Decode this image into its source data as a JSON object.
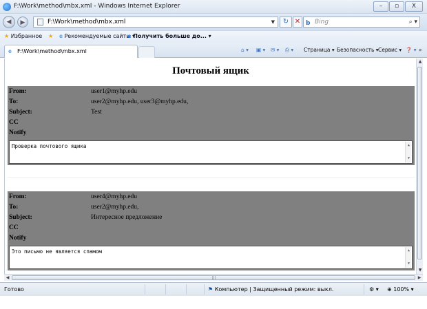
{
  "window": {
    "title": "F:\\Work\\method\\mbx.xml - Windows Internet Explorer",
    "minimize_icon": "minimize-icon",
    "maximize_icon": "maximize-icon",
    "close_glyph": "X"
  },
  "address_bar": {
    "url": "F:\\Work\\method\\mbx.xml",
    "search_placeholder": "Bing"
  },
  "favorites_bar": {
    "favorites_label": "Избранное",
    "suggested_sites_label": "Рекомендуемые сайты ▾",
    "get_more_label": "Получить больше до... ▾"
  },
  "tabs": [
    {
      "label": "F:\\Work\\method\\mbx.xml"
    }
  ],
  "command_bar": {
    "page_label": "Страница ▾",
    "safety_label": "Безопасность ▾",
    "tools_label": "Сервис ▾"
  },
  "page": {
    "title": "Почтовый ящик",
    "field_labels": {
      "from": "From:",
      "to": "To:",
      "subject": "Subject:",
      "cc": "CC",
      "notify": "Notify"
    },
    "messages": [
      {
        "from": "user1@myhp.edu",
        "to": "user2@myhp.edu, user3@myhp.edu,",
        "subject": "Test",
        "cc": "",
        "notify": "",
        "body": "Проверка почтового ящика"
      },
      {
        "from": "user4@myhp.edu",
        "to": "user2@myhp.edu,",
        "subject": "Интересное предложение",
        "cc": "",
        "notify": "",
        "body": "Это письмо не является спамом"
      }
    ]
  },
  "status_bar": {
    "status_text": "Готово",
    "zone_text": "Компьютер | Защищенный режим: выкл.",
    "zoom": "100%"
  },
  "colors": {
    "header_background": "#808080",
    "window_chrome": "#dbe5f1"
  }
}
